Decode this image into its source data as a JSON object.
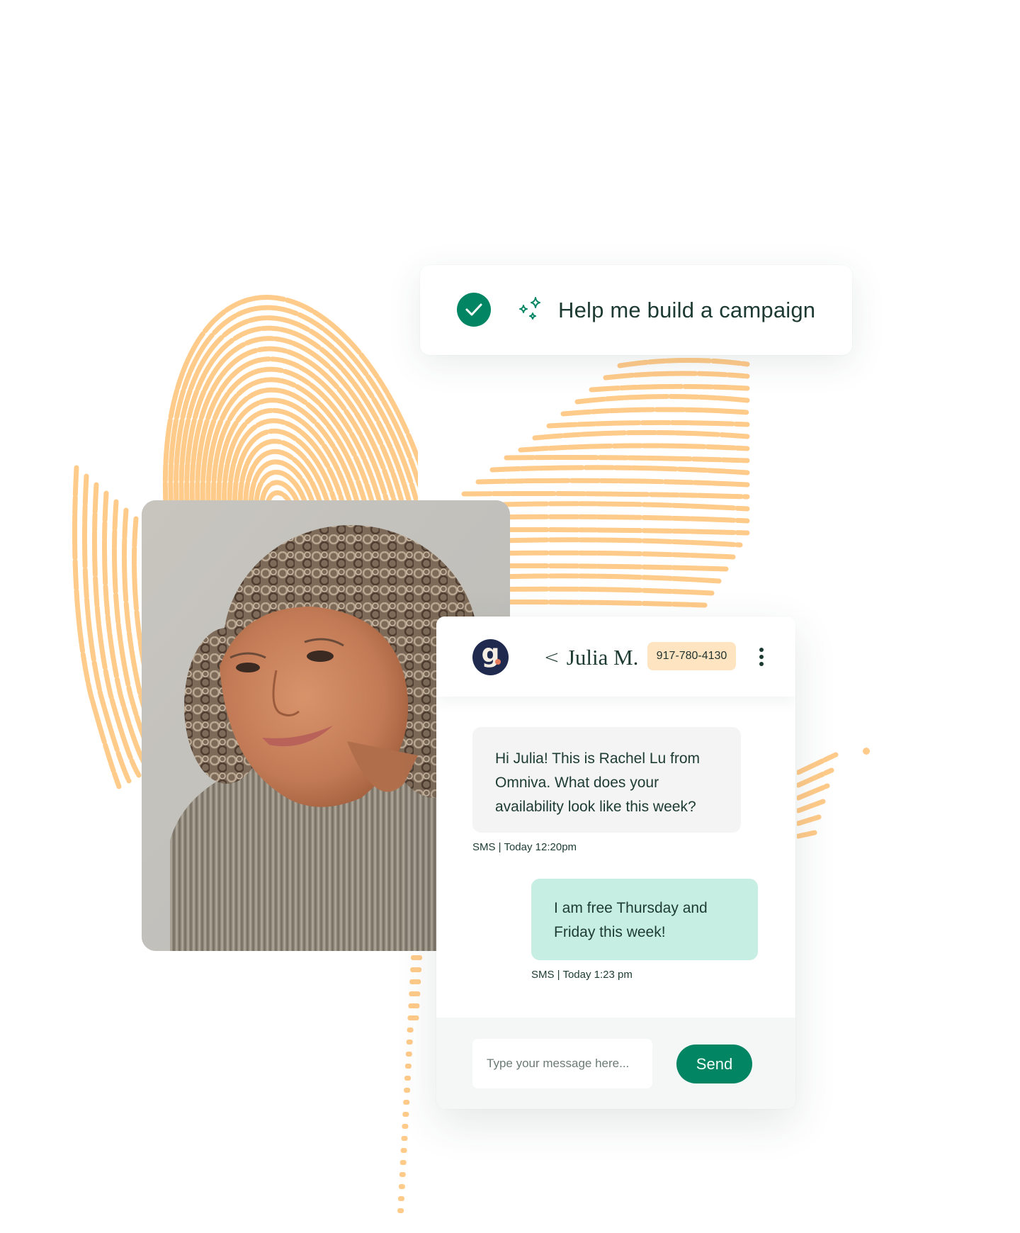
{
  "colors": {
    "accent_green": "#018563",
    "fingerprint": "#FFCB8A",
    "logo_navy": "#1F2A4E",
    "logo_dot": "#E77C5E",
    "phone_pill_bg": "#FFE4C2",
    "incoming_bubble": "#F4F4F4",
    "outgoing_bubble": "#C6EEE2",
    "text_dark": "#1D3B33"
  },
  "campaign_prompt": {
    "status_icon": "check-circle-icon",
    "sparkle_icon": "sparkle-icon",
    "text": "Help me build a campaign"
  },
  "photo": {
    "description": "Portrait of a smiling woman with curly grey-brown hair wearing a pleated taupe top"
  },
  "chat": {
    "logo_letter": "g",
    "back_icon": "chevron-left-icon",
    "contact_name": "Julia M.",
    "phone": "917-780-4130",
    "menu_icon": "more-vertical-icon",
    "messages": [
      {
        "direction": "incoming",
        "text": "Hi Julia! This is Rachel Lu from Omniva. What does your availability look like this week?",
        "meta": "SMS | Today 12:20pm"
      },
      {
        "direction": "outgoing",
        "text": "I am free Thursday and Friday this week!",
        "meta": "SMS | Today 1:23 pm"
      }
    ],
    "input_placeholder": "Type your message here...",
    "input_value": "",
    "send_label": "Send"
  }
}
